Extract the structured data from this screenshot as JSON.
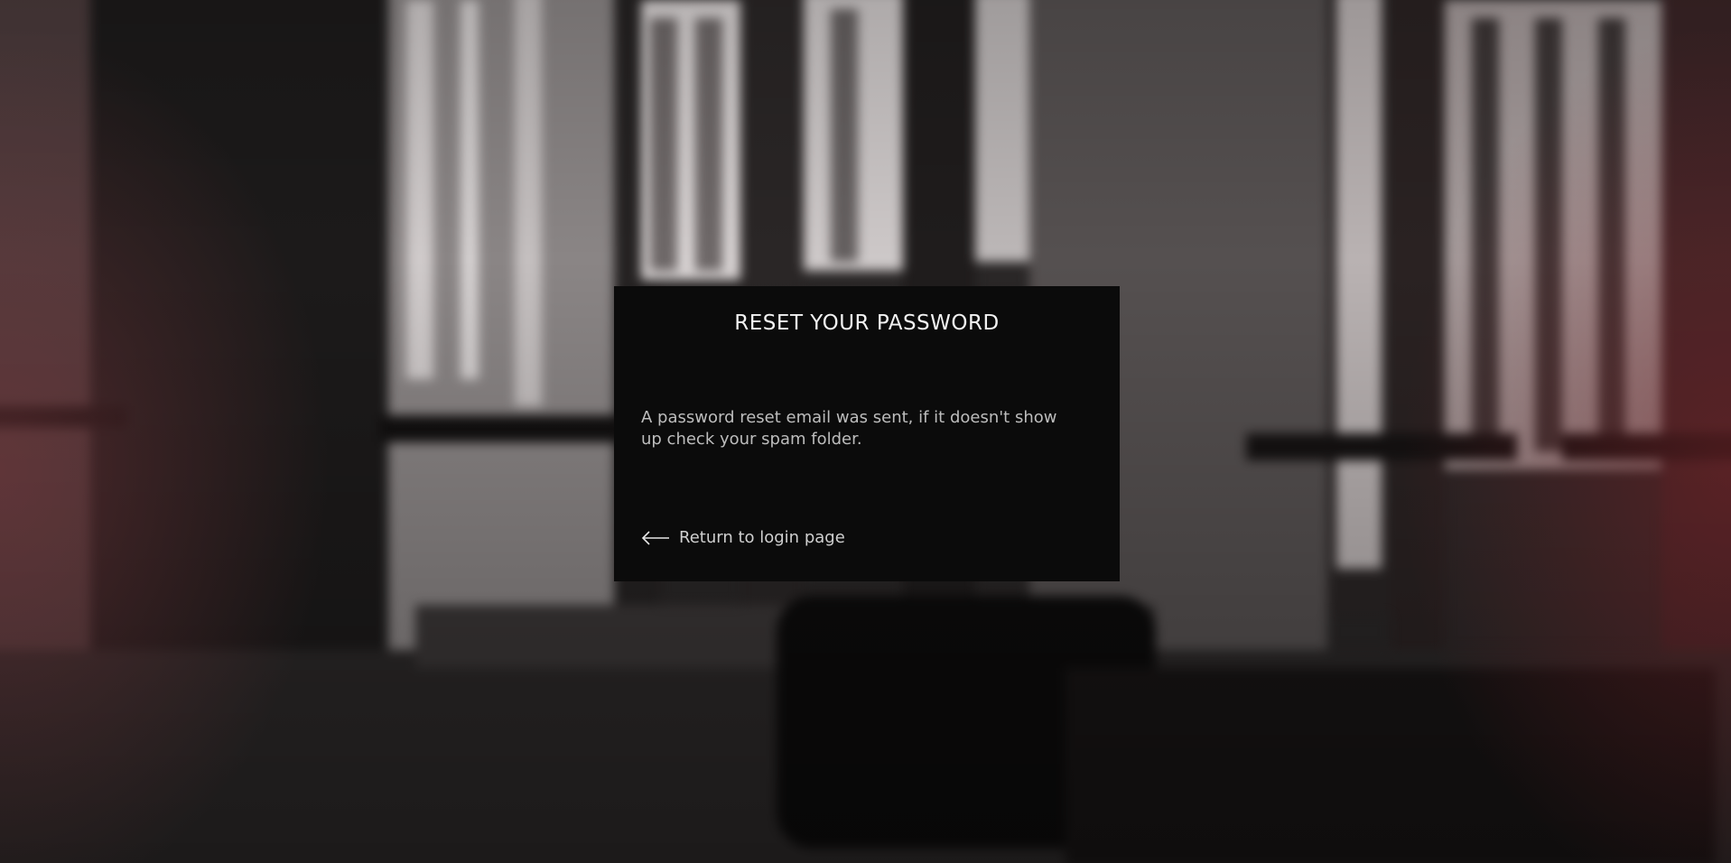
{
  "page": {
    "title": "RESET YOUR PASSWORD",
    "message": "A password reset email was sent, if it doesn't show up check your spam folder.",
    "return_link_label": "Return to login page",
    "return_icon": "arrow-left-icon"
  },
  "colors": {
    "card_background": "#0b0b0b",
    "title_text": "#f2f2f2",
    "body_text": "#bdbdbd",
    "backdrop_base": "#2a2727",
    "backdrop_tint": "#783741"
  }
}
